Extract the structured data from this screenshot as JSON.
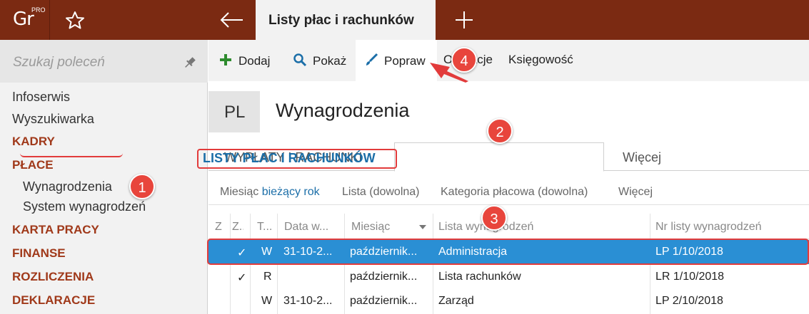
{
  "app": {
    "logo": "Gr",
    "logo_badge": "PRO"
  },
  "tabs": {
    "active_label": "Listy płac i rachunków"
  },
  "search": {
    "placeholder": "Szukaj poleceń"
  },
  "sidebar": {
    "items": [
      {
        "label": "Infoserwis"
      },
      {
        "label": "Wyszukiwarka"
      },
      {
        "label": "KADRY"
      },
      {
        "label": "PŁACE"
      },
      {
        "label": "Wynagrodzenia"
      },
      {
        "label": "System wynagrodzeń"
      },
      {
        "label": "KARTA PRACY"
      },
      {
        "label": "FINANSE"
      },
      {
        "label": "ROZLICZENIA"
      },
      {
        "label": "DEKLARACJE"
      }
    ]
  },
  "toolbar": {
    "add_label": "Dodaj",
    "show_label": "Pokaż",
    "edit_label": "Popraw",
    "operations_label": "Operacje",
    "accounting_label": "Księgowość"
  },
  "header": {
    "badge": "PL",
    "title": "Wynagrodzenia"
  },
  "subtabs": {
    "items": [
      {
        "label": "WYPŁATY I RACHUNKI"
      },
      {
        "label": "LISTY PŁAC I RACHUNKÓW"
      },
      {
        "label": "Więcej"
      }
    ]
  },
  "filters": {
    "month_label": "Miesiąc",
    "month_value": "bieżący rok",
    "list_label": "Lista (dowolna)",
    "category_label": "Kategoria płacowa (dowolna)",
    "more_label": "Więcej"
  },
  "table": {
    "columns": [
      "Z",
      "Z...",
      "T...",
      "Data w...",
      "Miesiąc",
      "Lista wynagrodzeń",
      "Nr listy wynagrodzeń"
    ],
    "rows": [
      {
        "z": "",
        "z2": "✓",
        "t": "W",
        "date": "31-10-2...",
        "month": "październik...",
        "list": "Administracja",
        "nr": "LP 1/10/2018"
      },
      {
        "z": "",
        "z2": "✓",
        "t": "R",
        "date": "",
        "month": "październik...",
        "list": "Lista rachunków",
        "nr": "LR 1/10/2018"
      },
      {
        "z": "",
        "z2": "",
        "t": "W",
        "date": "31-10-2...",
        "month": "październik...",
        "list": "Zarząd",
        "nr": "LP 2/10/2018"
      }
    ]
  },
  "callouts": [
    "1",
    "2",
    "3",
    "4"
  ],
  "colors": {
    "brand": "#7b2a12",
    "accent": "#2a8fd4",
    "section": "#a0391a",
    "callout": "#e8453c"
  }
}
